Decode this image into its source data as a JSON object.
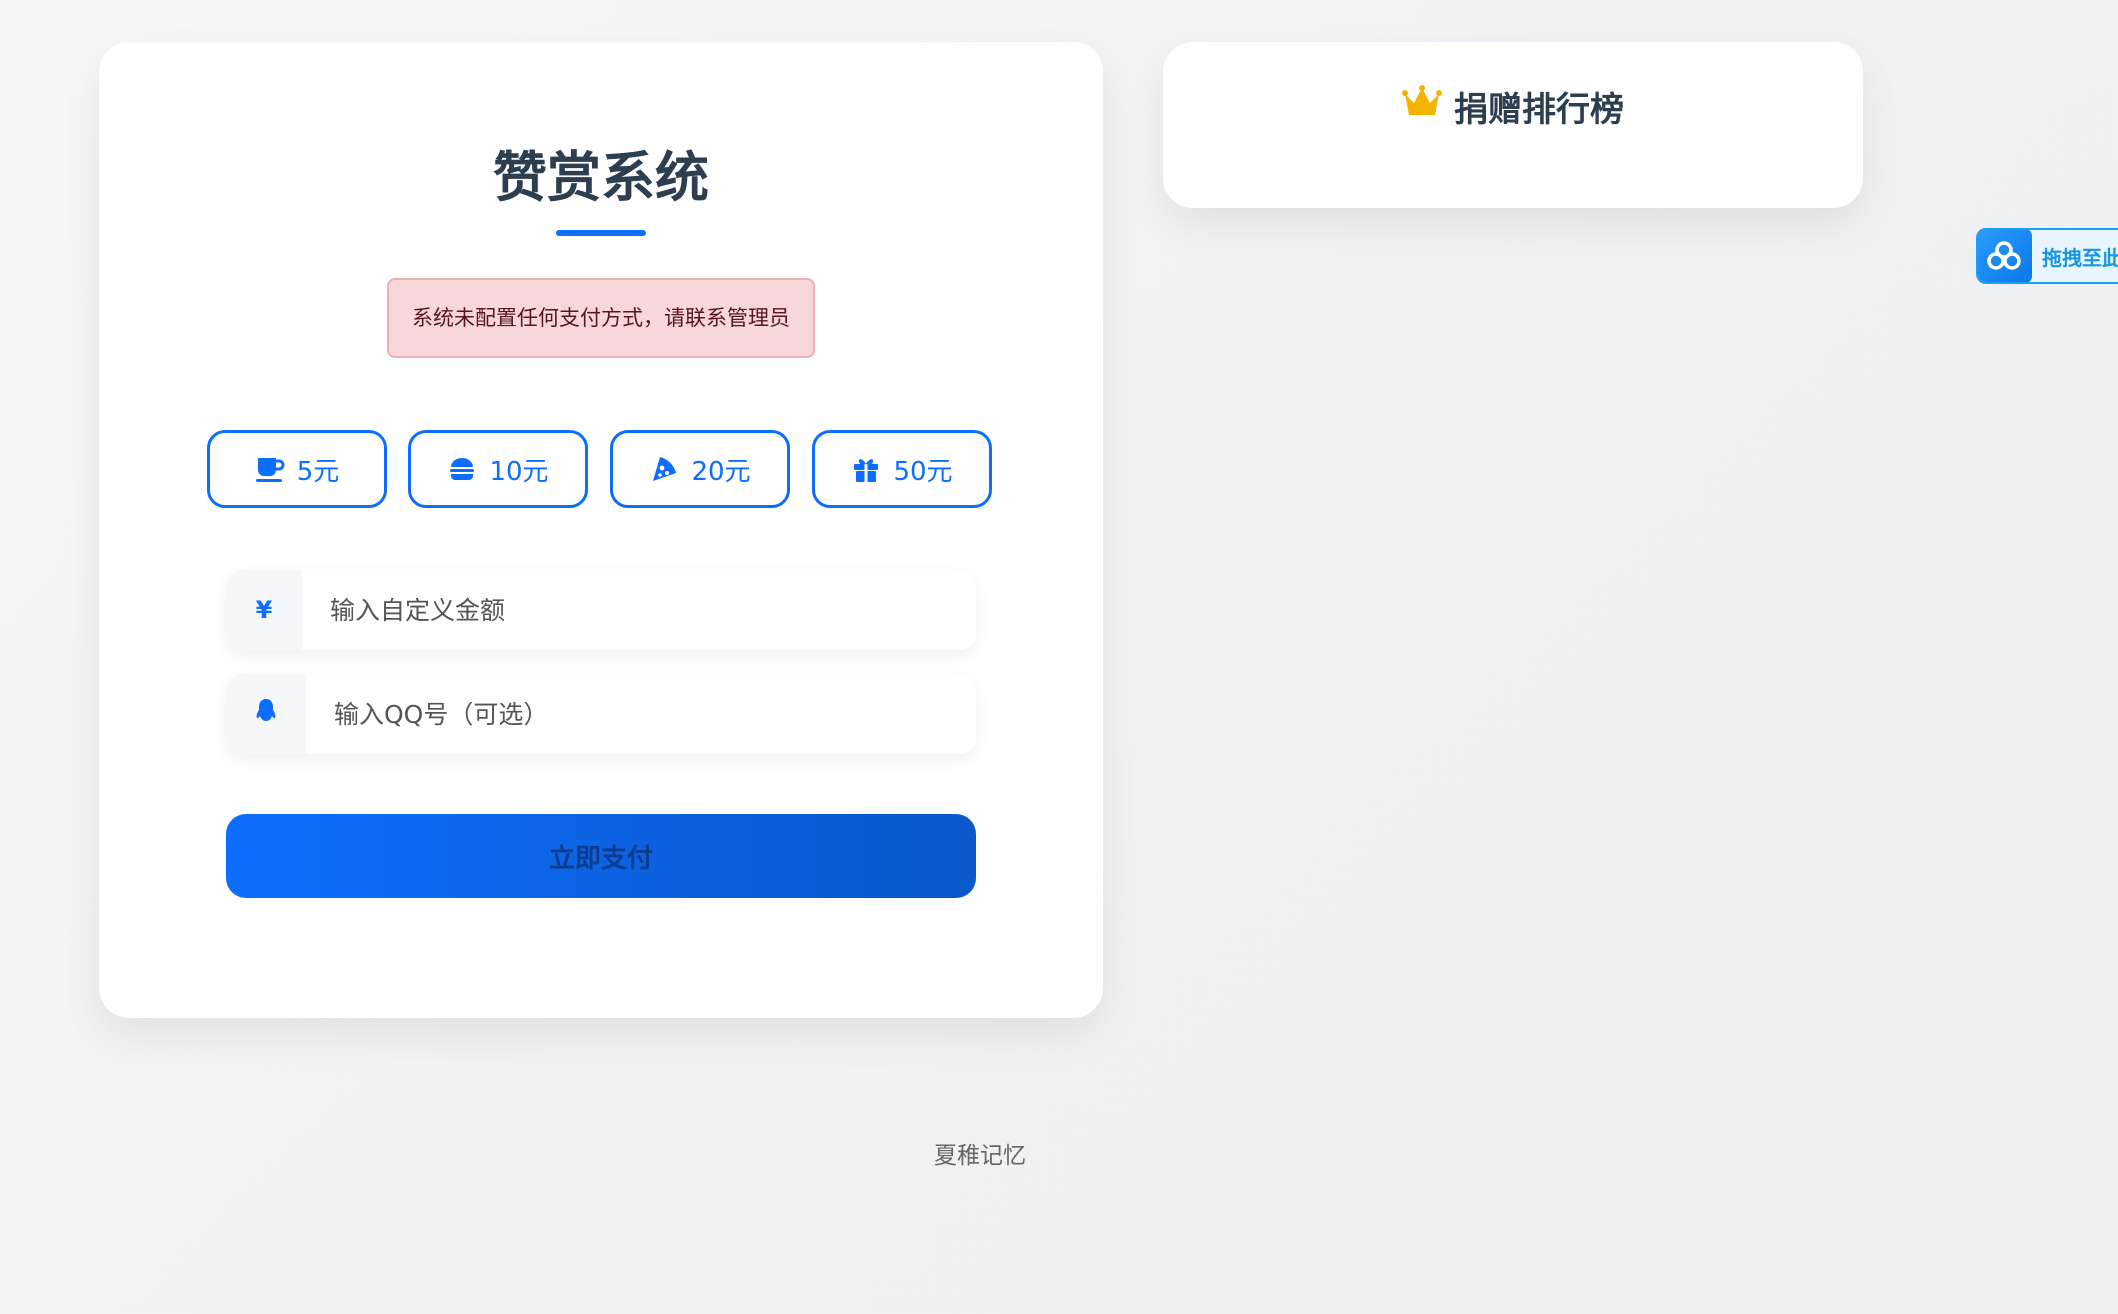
{
  "main": {
    "title": "赞赏系统",
    "alert": "系统未配置任何支付方式，请联系管理员",
    "amount_buttons": [
      {
        "icon": "coffee-icon",
        "label": "5元"
      },
      {
        "icon": "hamburger-icon",
        "label": "10元"
      },
      {
        "icon": "pizza-icon",
        "label": "20元"
      },
      {
        "icon": "gift-icon",
        "label": "50元"
      }
    ],
    "amount_input": {
      "prefix": "¥",
      "placeholder": "输入自定义金额",
      "value": ""
    },
    "qq_input": {
      "prefix_icon": "qq-penguin-icon",
      "placeholder": "输入QQ号（可选）",
      "value": ""
    },
    "pay_button_label": "立即支付"
  },
  "ranking": {
    "icon": "crown-icon",
    "title": "捐赠排行榜"
  },
  "footer": {
    "text": "夏稚记忆"
  },
  "float_widget": {
    "icon": "baidu-netdisk-icon",
    "label": "拖拽至此"
  },
  "colors": {
    "accent": "#0d6efd",
    "alert_bg": "#f8d7da",
    "alert_text": "#58151c",
    "crown": "#f5b301",
    "title": "#2c3e50"
  }
}
